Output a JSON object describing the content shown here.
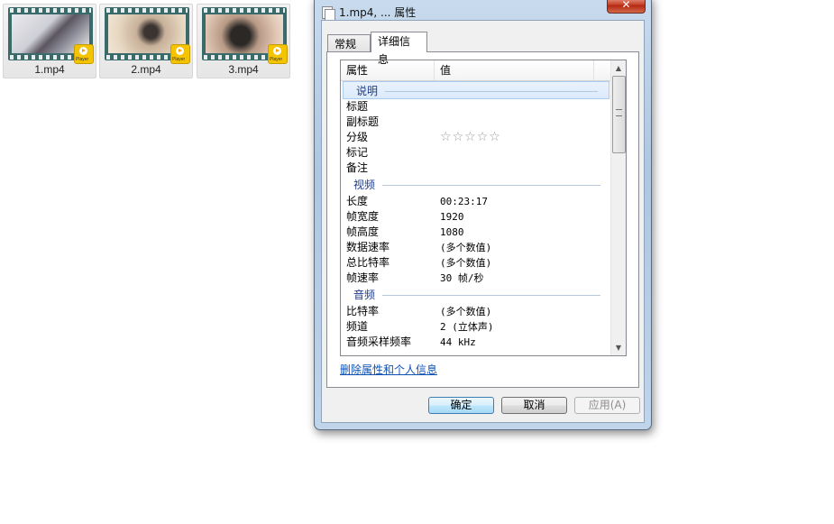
{
  "explorer": {
    "files": [
      {
        "name": "1.mp4",
        "badge": "Player"
      },
      {
        "name": "2.mp4",
        "badge": "Player"
      },
      {
        "name": "3.mp4",
        "badge": "Player"
      }
    ]
  },
  "dialog": {
    "title": "1.mp4, ... 属性",
    "close_label": "✕",
    "tabs": [
      {
        "label": "常规"
      },
      {
        "label": "详细信息"
      }
    ],
    "columns": {
      "property": "属性",
      "value": "值"
    },
    "groups": {
      "description": {
        "label": "说明",
        "rows": [
          {
            "key": "标题",
            "value": ""
          },
          {
            "key": "副标题",
            "value": ""
          },
          {
            "key": "分级",
            "value": ""
          },
          {
            "key": "标记",
            "value": ""
          },
          {
            "key": "备注",
            "value": ""
          }
        ],
        "rating_stars": 0
      },
      "video": {
        "label": "视频",
        "rows": [
          {
            "key": "长度",
            "value": "00:23:17"
          },
          {
            "key": "帧宽度",
            "value": "1920"
          },
          {
            "key": "帧高度",
            "value": "1080"
          },
          {
            "key": "数据速率",
            "value": "(多个数值)"
          },
          {
            "key": "总比特率",
            "value": "(多个数值)"
          },
          {
            "key": "帧速率",
            "value": "30 帧/秒"
          }
        ]
      },
      "audio": {
        "label": "音频",
        "rows": [
          {
            "key": "比特率",
            "value": "(多个数值)"
          },
          {
            "key": "频道",
            "value": "2 (立体声)"
          },
          {
            "key": "音频采样频率",
            "value": "44 kHz"
          }
        ]
      }
    },
    "remove_link": "删除属性和个人信息",
    "buttons": {
      "ok": "确定",
      "cancel": "取消",
      "apply": "应用(A)"
    }
  }
}
